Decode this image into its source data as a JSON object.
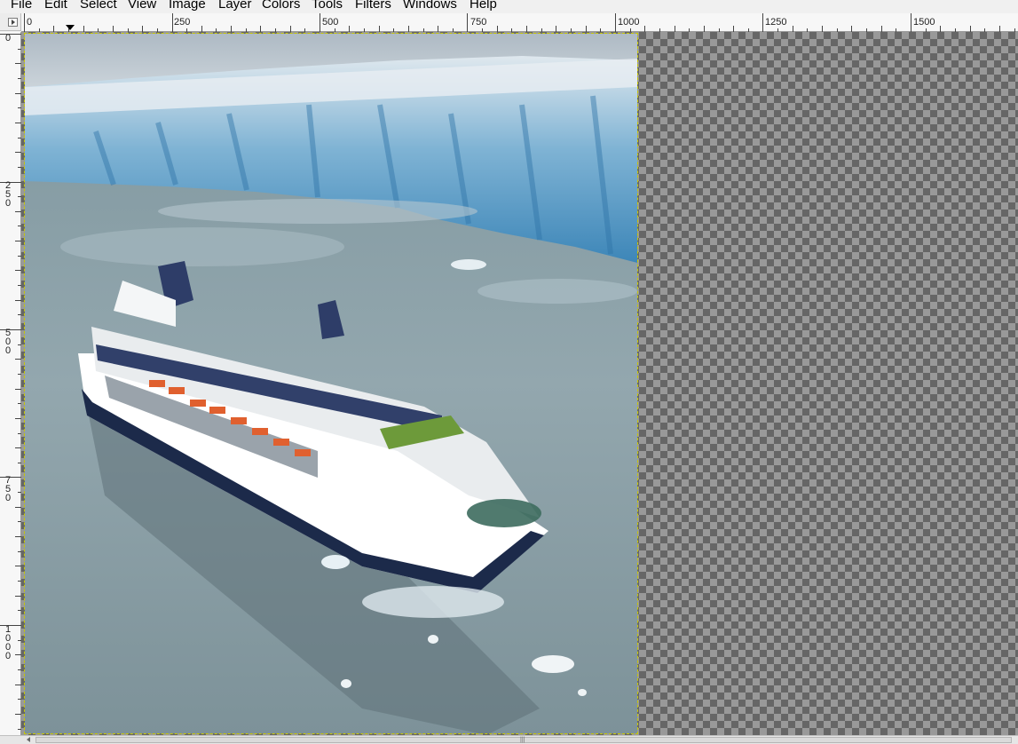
{
  "menu": [
    {
      "label": "File"
    },
    {
      "label": "Edit"
    },
    {
      "label": "Select"
    },
    {
      "label": "View"
    },
    {
      "label": "Image"
    },
    {
      "label": "Layer"
    },
    {
      "label": "Colors"
    },
    {
      "label": "Tools"
    },
    {
      "label": "Filters"
    },
    {
      "label": "Windows"
    },
    {
      "label": "Help"
    }
  ],
  "hruler_labels": [
    "0",
    "250",
    "500",
    "750",
    "1000",
    "1250",
    "1500"
  ],
  "vruler_labels": [
    "0",
    "250",
    "500",
    "750",
    "1000"
  ],
  "icons": {
    "ruler_toggle": "triangle-right-icon",
    "scroll_left": "arrow-left-icon",
    "scroll_grip": "grip-icon"
  },
  "colors": {
    "selection_outline": "#c8c800",
    "checker_dark": "#666666",
    "checker_light": "#999999"
  }
}
